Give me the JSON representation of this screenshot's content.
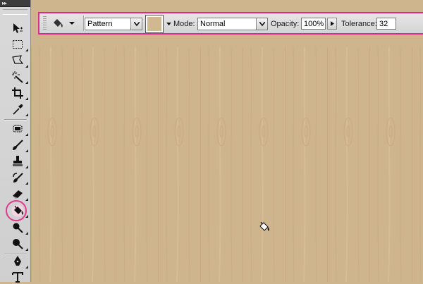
{
  "options_bar": {
    "fill_source": "Pattern",
    "mode_label": "Mode:",
    "mode_value": "Normal",
    "opacity_label": "Opacity:",
    "opacity_value": "100%",
    "tolerance_label": "Tolerance:",
    "tolerance_value": "32",
    "pattern_swatch_color": "#d2b891"
  },
  "tools_panel": {
    "header": "▸▸",
    "active_tool": "paint-bucket",
    "highlight_color": "#e2388d",
    "tools": [
      "move",
      "marquee",
      "lasso",
      "magic-wand",
      "crop",
      "eyedropper",
      "healing-brush",
      "brush",
      "clone-stamp",
      "history-brush",
      "eraser",
      "paint-bucket",
      "dodge",
      "burn",
      "pen",
      "type"
    ]
  },
  "canvas": {
    "pattern": "wood-planks",
    "base_color": "#cfb58e",
    "cursor_icon": "paint-bucket-cursor"
  },
  "colors": {
    "highlight": "#e02a86",
    "ui_gray": "#d9d9d9"
  }
}
